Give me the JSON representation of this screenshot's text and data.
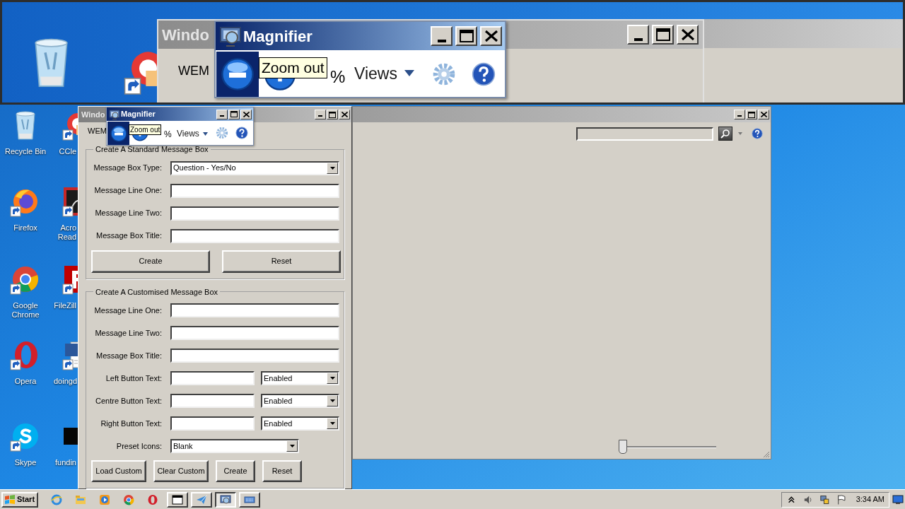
{
  "magnifier_lens": {
    "window_title": "Windo",
    "menu_text": "WEM",
    "magnifier_title": "Magnifier",
    "zoom_out_hover": true,
    "tooltip": "Zoom out",
    "zoom_percent": "%",
    "views_label": "Views"
  },
  "desktop_icons": [
    {
      "kind": "recycle-bin",
      "label": "Recycle Bin"
    },
    {
      "kind": "ccleaner",
      "label": "CCle"
    },
    {
      "kind": "firefox",
      "label": "Firefox"
    },
    {
      "kind": "acrobat",
      "label": "Acro Read"
    },
    {
      "kind": "chrome",
      "label": "Google Chrome"
    },
    {
      "kind": "filezilla",
      "label": "FileZill"
    },
    {
      "kind": "opera",
      "label": "Opera"
    },
    {
      "kind": "word",
      "label": "doingd"
    },
    {
      "kind": "skype",
      "label": "Skype"
    },
    {
      "kind": "black-file",
      "label": "fundin"
    }
  ],
  "main_window": {
    "title": "Windo",
    "menu": [
      "WEM"
    ],
    "standard_group": {
      "title": "Create A Standard Message Box",
      "fields": [
        {
          "kind": "select",
          "label": "Message Box Type:",
          "value": "Question - Yes/No"
        },
        {
          "kind": "text",
          "label": "Message Line One:"
        },
        {
          "kind": "text",
          "label": "Message Line Two:"
        },
        {
          "kind": "text",
          "label": "Message Box Title:"
        }
      ],
      "buttons": [
        "Create",
        "Reset"
      ]
    },
    "custom_group": {
      "title": "Create A Customised Message Box",
      "fields": [
        {
          "kind": "text",
          "label": "Message Line One:"
        },
        {
          "kind": "text",
          "label": "Message Line Two:"
        },
        {
          "kind": "text",
          "label": "Message Box Title:"
        },
        {
          "kind": "text-select",
          "label": "Left Button Text:",
          "value": "Enabled"
        },
        {
          "kind": "text-select",
          "label": "Centre Button Text:",
          "value": "Enabled"
        },
        {
          "kind": "text-select",
          "label": "Right Button Text:",
          "value": "Enabled"
        },
        {
          "kind": "short-select",
          "label": "Preset Icons:",
          "value": "Blank"
        }
      ],
      "buttons": [
        "Load Custom",
        "Clear Custom",
        "Create",
        "Reset"
      ]
    }
  },
  "magnifier": {
    "title": "Magnifier",
    "zoom_out_hover": true,
    "tooltip": "Zoom out",
    "zoom_percent": "%",
    "views_label": "Views"
  },
  "explorer_window": {
    "slider": {
      "level": 0
    }
  },
  "taskbar": {
    "start": "Start",
    "quick_launch": [
      {
        "kind": "ie"
      },
      {
        "kind": "folder"
      },
      {
        "kind": "media"
      },
      {
        "kind": "chrome"
      },
      {
        "kind": "opera"
      }
    ],
    "tasks": [
      {
        "kind": "window",
        "pressed": false
      },
      {
        "kind": "plane",
        "pressed": false
      },
      {
        "kind": "magnifier",
        "pressed": true
      },
      {
        "kind": "keyboard",
        "pressed": false
      }
    ],
    "tray": [
      {
        "kind": "chevron"
      },
      {
        "kind": "speaker"
      },
      {
        "kind": "network"
      },
      {
        "kind": "flag"
      }
    ],
    "clock": "3:34 AM"
  }
}
